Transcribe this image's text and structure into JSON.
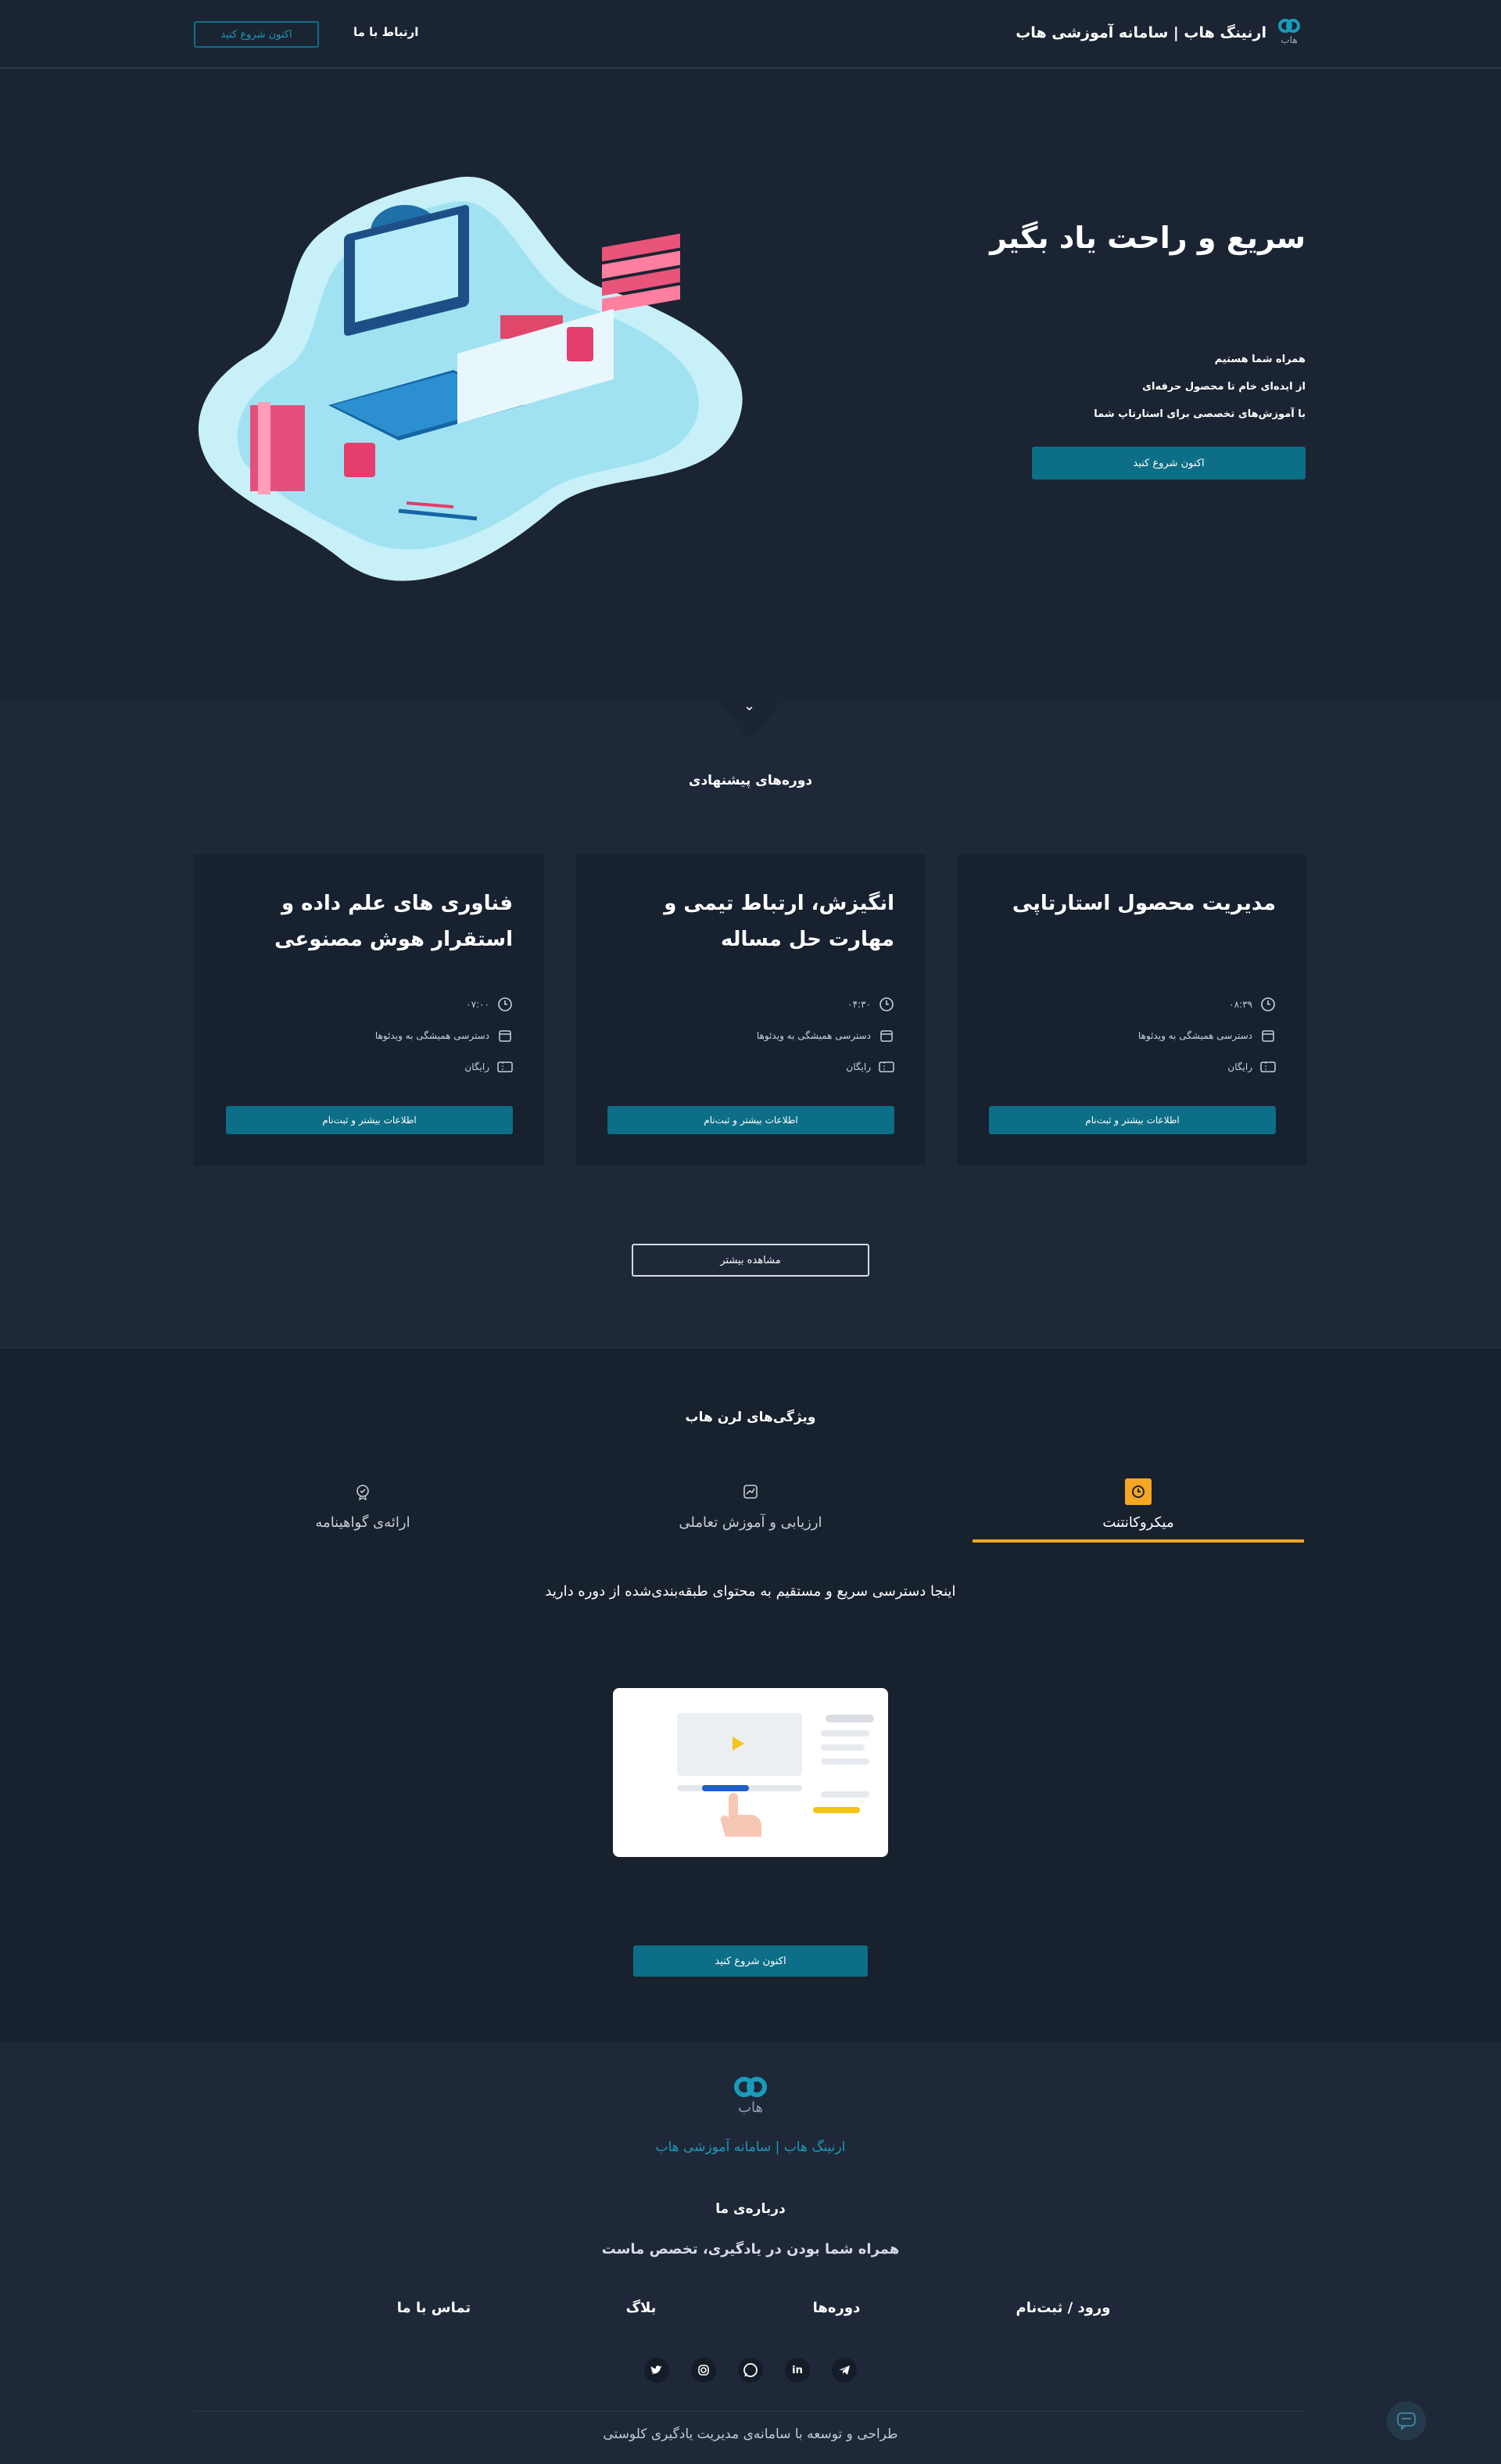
{
  "header": {
    "brand_title": "ارنینگ هاب | سامانه آموزشی هاب",
    "logo_text": "هاب",
    "contact_link": "ارتباط با ما",
    "start_button": "اکنون شروع کنید"
  },
  "hero": {
    "title": "سریع و راحت یاد بگیر",
    "lines": [
      "همراه شما هستیم",
      "از ایده‌ای خام تا محصول حرفه‌ای",
      "با آموزش‌های تخصصی برای استارتاپ شما"
    ],
    "cta": "اکنون شروع کنید"
  },
  "courses": {
    "title": "دوره‌های پیشنهادی",
    "items": [
      {
        "title": "مدیریت محصول استارتاپی",
        "duration": "۰۸:۳۹",
        "access": "دسترسی همیشگی به ویدئوها",
        "price": "رایگان",
        "button": "اطلاعات بیشتر و ثبت‌نام"
      },
      {
        "title": "انگیزش، ارتباط تیمی و مهارت حل مساله",
        "duration": "۰۴:۳۰",
        "access": "دسترسی همیشگی به ویدئوها",
        "price": "رایگان",
        "button": "اطلاعات بیشتر و ثبت‌نام"
      },
      {
        "title": "فناوری های علم داده و استقرار هوش مصنوعی",
        "duration": "۰۷:۰۰",
        "access": "دسترسی همیشگی به ویدئوها",
        "price": "رایگان",
        "button": "اطلاعات بیشتر و ثبت‌نام"
      }
    ],
    "more_button": "مشاهده بیشتر"
  },
  "features": {
    "title": "ویژگی‌های لرن هاب",
    "tabs": [
      {
        "label": "میکروکانتنت",
        "icon": "clock-icon",
        "active": true
      },
      {
        "label": "ارزیابی و آموزش تعاملی",
        "icon": "chart-icon",
        "active": false
      },
      {
        "label": "ارائه‌ی گواهینامه",
        "icon": "badge-icon",
        "active": false
      }
    ],
    "description": "اینجا دسترسی سریع و مستقیم به محتوای طبقه‌بندی‌شده از دوره دارید",
    "cta": "اکنون شروع کنید"
  },
  "footer": {
    "logo_text": "هاب",
    "brand": "ارنینگ هاب | سامانه آموزشی هاب",
    "about_title": "درباره‌ی ما",
    "tagline": "همراه شما بودن در یادگیری، تخصص ماست",
    "links": [
      "ورود / ثبت‌نام",
      "دوره‌ها",
      "بلاگ",
      "تماس با ما"
    ],
    "social": [
      "telegram-icon",
      "linkedin-icon",
      "whatsapp-icon",
      "instagram-icon",
      "twitter-icon"
    ],
    "credit": "طراحی و توسعه با سامانه‌ی مدیریت یادگیری کلوستی"
  },
  "colors": {
    "accent": "#0d6e87",
    "tab_active": "#f5a623",
    "brand_link": "#1a9bbb"
  }
}
